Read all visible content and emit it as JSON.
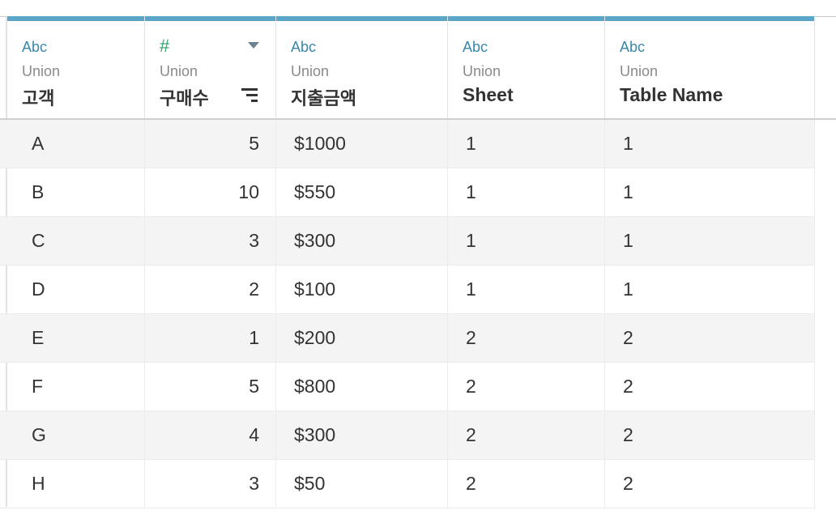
{
  "columns": [
    {
      "type_label": "Abc",
      "source": "Union",
      "name": "고객"
    },
    {
      "type_label": "#",
      "source": "Union",
      "name": "구매수"
    },
    {
      "type_label": "Abc",
      "source": "Union",
      "name": "지출금액"
    },
    {
      "type_label": "Abc",
      "source": "Union",
      "name": "Sheet"
    },
    {
      "type_label": "Abc",
      "source": "Union",
      "name": "Table Name"
    }
  ],
  "rows": [
    [
      "A",
      "5",
      "$1000",
      "1",
      "1"
    ],
    [
      "B",
      "10",
      "$550",
      "1",
      "1"
    ],
    [
      "C",
      "3",
      "$300",
      "1",
      "1"
    ],
    [
      "D",
      "2",
      "$100",
      "1",
      "1"
    ],
    [
      "E",
      "1",
      "$200",
      "2",
      "2"
    ],
    [
      "F",
      "5",
      "$800",
      "2",
      "2"
    ],
    [
      "G",
      "4",
      "$300",
      "2",
      "2"
    ],
    [
      "H",
      "3",
      "$50",
      "2",
      "2"
    ]
  ],
  "colors": {
    "header_bar": "#5ba5c8",
    "string_type": "#3a86a8",
    "number_type": "#2da26b"
  },
  "icons": {
    "column_menu": "dropdown-arrow-icon",
    "sort": "sort-descending-icon"
  }
}
